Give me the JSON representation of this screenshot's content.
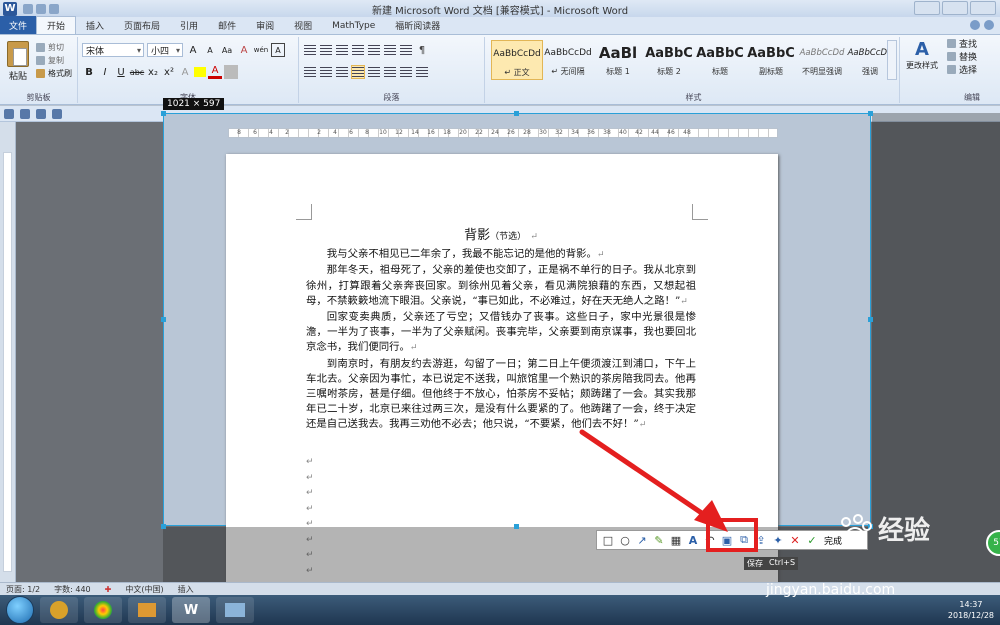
{
  "window": {
    "title": "新建 Microsoft Word 文档 [兼容模式] - Microsoft Word",
    "app_icon": "W"
  },
  "tabs": [
    "文件",
    "开始",
    "插入",
    "页面布局",
    "引用",
    "邮件",
    "审阅",
    "视图",
    "MathType",
    "福昕阅读器"
  ],
  "ribbon": {
    "clipboard": {
      "paste": "粘贴",
      "cut": "剪切",
      "copy": "复制",
      "format_painter": "格式刷",
      "label": "剪贴板"
    },
    "font": {
      "name": "宋体",
      "size": "小四",
      "label": "字体",
      "bold": "B",
      "italic": "I",
      "underline": "U",
      "strike": "abc",
      "sub": "x₂",
      "sup": "x²",
      "color": "A",
      "aa": "Aa",
      "grow": "A",
      "shrink": "A",
      "clear": "A",
      "wen": "wén",
      "border": "A"
    },
    "paragraph": {
      "label": "段落"
    },
    "styles": {
      "label": "样式",
      "items": [
        {
          "sample": "AaBbCcDd",
          "name": "↵ 正文"
        },
        {
          "sample": "AaBbCcDd",
          "name": "↵ 无间隔"
        },
        {
          "sample": "AaBl",
          "name": "标题 1"
        },
        {
          "sample": "AaBbC",
          "name": "标题 2"
        },
        {
          "sample": "AaBbC",
          "name": "标题"
        },
        {
          "sample": "AaBbC",
          "name": "副标题"
        },
        {
          "sample": "AaBbCcDd",
          "name": "不明显强调"
        },
        {
          "sample": "AaBbCcDd",
          "name": "强调"
        }
      ],
      "change_styles": "更改样式"
    },
    "editing": {
      "find": "查找",
      "replace": "替换",
      "select": "选择",
      "label": "编辑"
    }
  },
  "screenshot": {
    "dimensions": "1021 × 597",
    "save_tip": "保存",
    "save_tip2": "Ctrl+S",
    "done": "完成"
  },
  "ruler": [
    "8",
    "6",
    "4",
    "2",
    "",
    "2",
    "4",
    "6",
    "8",
    "10",
    "12",
    "14",
    "16",
    "18",
    "20",
    "22",
    "24",
    "26",
    "28",
    "30",
    "32",
    "34",
    "36",
    "38",
    "40",
    "42",
    "44",
    "46",
    "48"
  ],
  "document": {
    "title": "背影",
    "title_note": "（节选）",
    "paragraphs": [
      "我与父亲不相见已二年余了，我最不能忘记的是他的背影。",
      "那年冬天，祖母死了，父亲的差使也交卸了，正是祸不单行的日子。我从北京到徐州，打算跟着父亲奔丧回家。到徐州见着父亲，看见满院狼藉的东西，又想起祖母，不禁簌簌地流下眼泪。父亲说，“事已如此，不必难过，好在天无绝人之路！”",
      "回家变卖典质，父亲还了亏空；又借钱办了丧事。这些日子，家中光景很是惨澹，一半为了丧事，一半为了父亲赋闲。丧事完毕，父亲要到南京谋事，我也要回北京念书，我们便同行。",
      "到南京时，有朋友约去游逛，勾留了一日；第二日上午便须渡江到浦口，下午上车北去。父亲因为事忙，本已说定不送我，叫旅馆里一个熟识的茶房陪我同去。他再三嘱咐茶房，甚是仔细。但他终于不放心，怕茶房不妥帖；颇踌躇了一会。其实我那年已二十岁，北京已来往过两三次，是没有什么要紧的了。他踌躇了一会，终于决定还是自己送我去。我再三劝他不必去；他只说，“不要紧，他们去不好！”"
    ],
    "para_mark": "↵"
  },
  "statusbar": {
    "page": "页面: 1/2",
    "words": "字数: 440",
    "lang": "中文(中国)",
    "mode": "插入"
  },
  "taskbar": {
    "word": "W",
    "time": "14:37",
    "date": "2018/12/28"
  },
  "watermark": {
    "brand": "经验",
    "url": "jingyan.baidu.com"
  },
  "badge": "57",
  "colors": {
    "accent": "#2b5fa8",
    "selection": "#2aa0d8",
    "highlight": "#e41f1f"
  }
}
